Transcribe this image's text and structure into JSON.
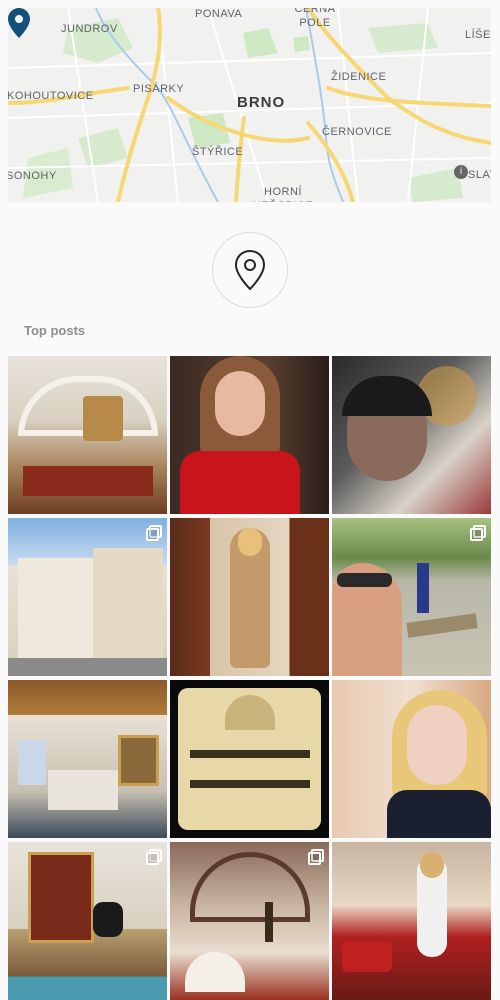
{
  "map": {
    "labels": {
      "jundrov": "JUNDROV",
      "ponava": "PONAVA",
      "cerna_pole": "ČERNÁ POLE",
      "lisen": "LÍŠEŇ",
      "kohoutovice": "KOHOUTOVICE",
      "pisarky": "PISÁRKY",
      "brno": "BRNO",
      "zidenice": "ŽIDENICE",
      "cernovice": "ČERNOVICE",
      "styrice": "ŠTÝŘICE",
      "sonohy": "SONOHY",
      "horni_herspice": "HORNÍ HEŘSPICE",
      "slatina": "SLATINA"
    }
  },
  "location_icon": "location-pin-icon",
  "top_posts": {
    "title": "Top posts",
    "posts": [
      {
        "subject": "vaulted-hall-interior",
        "multi": false
      },
      {
        "subject": "woman-portrait-red",
        "multi": false
      },
      {
        "subject": "woman-selfie-stained-glass",
        "multi": false
      },
      {
        "subject": "hotel-facade-street",
        "multi": true
      },
      {
        "subject": "woman-in-doorway",
        "multi": false
      },
      {
        "subject": "river-selfie",
        "multi": true
      },
      {
        "subject": "hotel-bedroom-wood-ceiling",
        "multi": false
      },
      {
        "subject": "building-facade-night",
        "multi": false
      },
      {
        "subject": "woman-selfie-uniform",
        "multi": false
      },
      {
        "subject": "woman-on-bed-tapestry",
        "multi": true
      },
      {
        "subject": "vaulted-dining-room",
        "multi": true
      },
      {
        "subject": "woman-on-red-sofa",
        "multi": false
      }
    ]
  },
  "colors": {
    "background": "#fafafa",
    "map_road": "#f6d774",
    "map_park": "#cfe8c4",
    "pin": "#13507a"
  }
}
